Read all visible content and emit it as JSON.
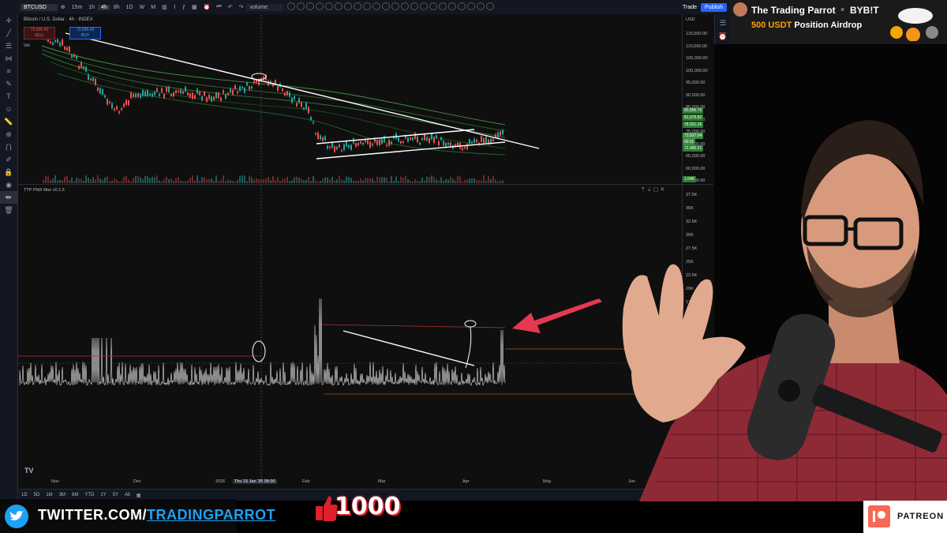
{
  "toolbar": {
    "symbol": "BTCUSD",
    "timeframes": [
      "15m",
      "1h",
      "4h",
      "8h",
      "1D",
      "W",
      "M"
    ],
    "indicator_search": "volume",
    "trade_label": "Trade",
    "publish_label": "Publish"
  },
  "chart": {
    "title": "Bitcoin / U.S. Dollar · 4h · INDEX",
    "sell_price": "73,936.43",
    "sell_label": "SELL",
    "buy_price": "73,936.43",
    "buy_label": "BUY",
    "vol_label": "Vol",
    "currency": "USD",
    "price_ticks": [
      "115,000.00",
      "110,000.00",
      "105,000.00",
      "100,000.00",
      "95,000.00",
      "90,000.00",
      "85,000.00",
      "80,000.00",
      "75,000.00",
      "70,000.00",
      "65,000.00",
      "60,000.00",
      "55,000.00"
    ],
    "price_badges": [
      {
        "text": "83,856.76",
        "color": "#2e7d32"
      },
      {
        "text": "81,676.82",
        "color": "#2e7d32"
      },
      {
        "text": "78,921.16",
        "color": "#2e7d32"
      },
      {
        "text": "73,937.04",
        "color": "#388e3c"
      },
      {
        "text": "00:11",
        "color": "#388e3c"
      },
      {
        "text": "72,480.21",
        "color": "#2e7d32"
      }
    ],
    "volume_badge": "1.64K",
    "indicator_name": "TTP PNR filter v0.1.5",
    "indicator_ticks": [
      "37.5K",
      "35K",
      "32.5K",
      "30K",
      "27.5K",
      "25K",
      "22.5K",
      "20K",
      "17.5K"
    ],
    "x_ticks": [
      "Nov",
      "Dec",
      "2026",
      "Thu 15 Jan '26  05:00",
      "Feb",
      "Mar",
      "Apr",
      "May",
      "Jun"
    ],
    "ranges": [
      "1D",
      "5D",
      "1M",
      "3M",
      "6M",
      "YTD",
      "1Y",
      "5Y",
      "All"
    ],
    "bottom_right": "13"
  },
  "overlay": {
    "brand": "The Trading Parrot",
    "x": "×",
    "partner": "BYB!T",
    "airdrop_amount": "500 USDT",
    "airdrop_text": "Position Airdrop",
    "twitter_prefix": "TWITTER.COM/",
    "twitter_handle": "TRADINGPARROT",
    "likes": "1000",
    "patreon": "PATREON"
  }
}
